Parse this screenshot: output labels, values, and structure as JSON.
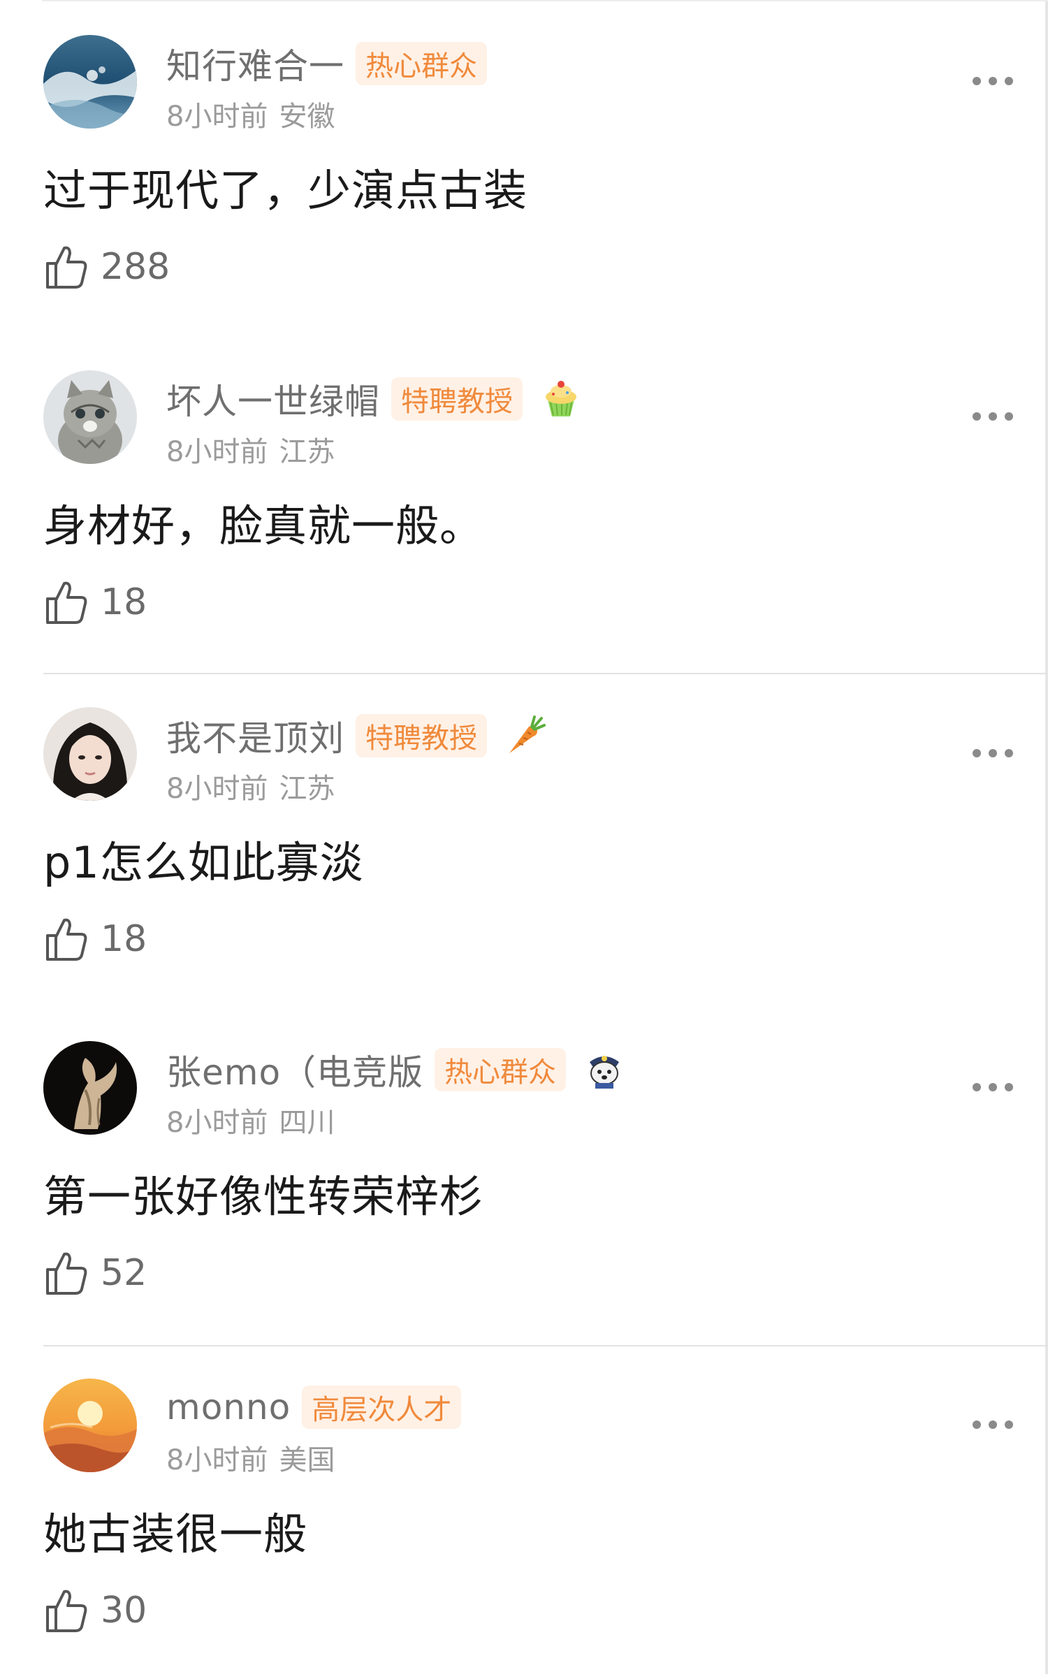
{
  "comments": [
    {
      "username": "知行难合一",
      "badge": "热心群众",
      "time": "8小时前",
      "location": "安徽",
      "text": "过于现代了，少演点古装",
      "likes": "288",
      "avatar_icon": "ocean-wave-avatar",
      "extra_icon": null
    },
    {
      "username": "坏人一世绿帽",
      "badge": "特聘教授",
      "time": "8小时前",
      "location": "江苏",
      "text": "身材好，脸真就一般。",
      "likes": "18",
      "avatar_icon": "kitten-avatar",
      "extra_icon": "cupcake-icon"
    },
    {
      "username": "我不是顶刘",
      "badge": "特聘教授",
      "time": "8小时前",
      "location": "江苏",
      "text": "p1怎么如此寡淡",
      "likes": "18",
      "avatar_icon": "woman-portrait-avatar",
      "extra_icon": "carrot-icon"
    },
    {
      "username": "张emo（电竞版",
      "badge": "热心群众",
      "time": "8小时前",
      "location": "四川",
      "text": "第一张好像性转荣梓杉",
      "likes": "52",
      "avatar_icon": "sculpture-avatar",
      "extra_icon": "police-dog-icon"
    },
    {
      "username": "monno",
      "badge": "高层次人才",
      "time": "8小时前",
      "location": "美国",
      "text": "她古装很一般",
      "likes": "30",
      "avatar_icon": "sunset-avatar",
      "extra_icon": null
    }
  ],
  "colors": {
    "badge_text": "#f08a3c",
    "badge_bg": "#fff1e6",
    "username": "#6f6f6f",
    "meta": "#9b9b9b"
  }
}
